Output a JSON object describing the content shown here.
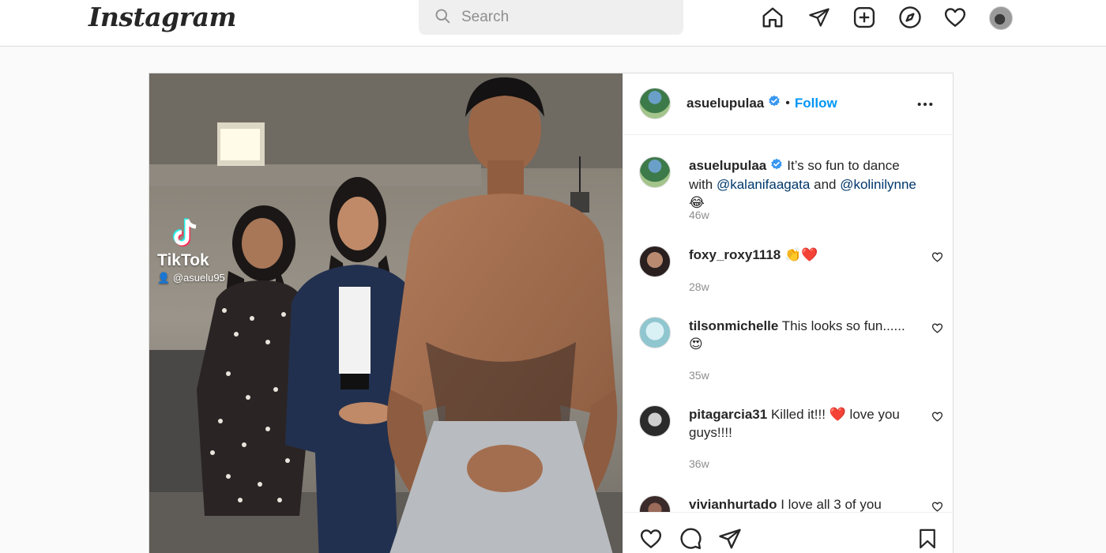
{
  "app": {
    "logo": "Instagram"
  },
  "search": {
    "placeholder": "Search"
  },
  "nav": {
    "icons": [
      "home-icon",
      "direct-icon",
      "new-post-icon",
      "explore-icon",
      "activity-icon",
      "profile-avatar"
    ]
  },
  "post": {
    "author": "asuelupulaa",
    "verified": true,
    "follow_label": "Follow",
    "separator": "•",
    "more_label": "•••",
    "media": {
      "overlay_brand": "TikTok",
      "overlay_handle": "@asuelu95"
    },
    "caption": {
      "user": "asuelupulaa",
      "text_before": "It’s so fun to dance with",
      "mention1": "@kalanifaagata",
      "and": "and",
      "mention2": "@kolinilynne",
      "emoji": "😂",
      "age": "46w"
    },
    "comments": [
      {
        "user": "foxy_roxy1118",
        "text": "👏❤️",
        "age": "28w"
      },
      {
        "user": "tilsonmichelle",
        "text": "This looks so fun......",
        "text2": "😍",
        "age": "35w"
      },
      {
        "user": "pitagarcia31",
        "text": "Killed it!!! ❤️ love you guys!!!!",
        "age": "36w"
      },
      {
        "user": "vivianhurtado",
        "text": "I love all 3 of you",
        "age": ""
      }
    ]
  },
  "colors": {
    "accent": "#0095f6",
    "border": "#dbdbdb",
    "muted": "#8e8e8e",
    "verified": "#3897f0"
  }
}
